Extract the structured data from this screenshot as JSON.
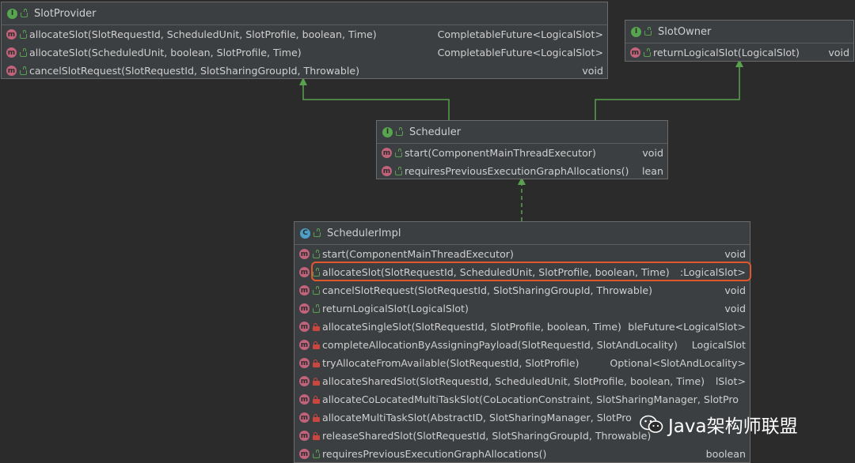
{
  "diagram": {
    "slot_provider": {
      "name": "SlotProvider",
      "kind_badge": "I",
      "methods": [
        {
          "badge": "m",
          "visibility": "public",
          "signature": "allocateSlot(SlotRequestId, ScheduledUnit, SlotProfile, boolean, Time)",
          "returns": "CompletableFuture<LogicalSlot>"
        },
        {
          "badge": "m",
          "visibility": "public",
          "signature": "allocateSlot(ScheduledUnit, boolean, SlotProfile, Time)",
          "returns": "CompletableFuture<LogicalSlot>"
        },
        {
          "badge": "m",
          "visibility": "public",
          "signature": "cancelSlotRequest(SlotRequestId, SlotSharingGroupId, Throwable)",
          "returns": "void"
        }
      ]
    },
    "slot_owner": {
      "name": "SlotOwner",
      "kind_badge": "I",
      "methods": [
        {
          "badge": "m",
          "visibility": "public",
          "signature": "returnLogicalSlot(LogicalSlot)",
          "returns": "void"
        }
      ]
    },
    "scheduler": {
      "name": "Scheduler",
      "kind_badge": "I",
      "methods": [
        {
          "badge": "m",
          "visibility": "public",
          "signature": "start(ComponentMainThreadExecutor)",
          "returns": "void"
        },
        {
          "badge": "m",
          "visibility": "public",
          "signature": "requiresPreviousExecutionGraphAllocations()",
          "returns": "lean"
        }
      ]
    },
    "scheduler_impl": {
      "name": "SchedulerImpl",
      "kind_badge": "C",
      "methods": [
        {
          "badge": "m",
          "visibility": "public",
          "signature": "start(ComponentMainThreadExecutor)",
          "returns": "void"
        },
        {
          "badge": "m",
          "visibility": "public",
          "signature": "allocateSlot(SlotRequestId, ScheduledUnit, SlotProfile, boolean, Time)",
          "returns": ":LogicalSlot>",
          "highlighted": true
        },
        {
          "badge": "m",
          "visibility": "public",
          "signature": "cancelSlotRequest(SlotRequestId, SlotSharingGroupId, Throwable)",
          "returns": "void"
        },
        {
          "badge": "m",
          "visibility": "public",
          "signature": "returnLogicalSlot(LogicalSlot)",
          "returns": "void"
        },
        {
          "badge": "m",
          "visibility": "private",
          "signature": "allocateSingleSlot(SlotRequestId, SlotProfile, boolean, Time)",
          "returns": "bleFuture<LogicalSlot>"
        },
        {
          "badge": "m",
          "visibility": "private",
          "signature": "completeAllocationByAssigningPayload(SlotRequestId, SlotAndLocality)",
          "returns": "LogicalSlot"
        },
        {
          "badge": "m",
          "visibility": "private",
          "signature": "tryAllocateFromAvailable(SlotRequestId, SlotProfile)",
          "returns": "Optional<SlotAndLocality>"
        },
        {
          "badge": "m",
          "visibility": "private",
          "signature": "allocateSharedSlot(SlotRequestId, ScheduledUnit, SlotProfile, boolean, Time)",
          "returns": "lSlot>"
        },
        {
          "badge": "m",
          "visibility": "private",
          "signature": "allocateCoLocatedMultiTaskSlot(CoLocationConstraint, SlotSharingManager, SlotPro",
          "returns": ""
        },
        {
          "badge": "m",
          "visibility": "private",
          "signature": "allocateMultiTaskSlot(AbstractID, SlotSharingManager, SlotPro",
          "returns": ""
        },
        {
          "badge": "m",
          "visibility": "private",
          "signature": "releaseSharedSlot(SlotRequestId, SlotSharingGroupId, Throwable)",
          "returns": ""
        },
        {
          "badge": "m",
          "visibility": "public",
          "signature": "requiresPreviousExecutionGraphAllocations()",
          "returns": "boolean"
        }
      ]
    }
  },
  "watermark": {
    "text": "Java架构师联盟",
    "icon": "wechat-icon"
  },
  "colors": {
    "background": "#2b2b2b",
    "box": "#3c3f41",
    "arrow": "#59a14f",
    "highlight": "#e0582b",
    "interface_badge": "#57a54f",
    "class_badge": "#4d9fc7",
    "method_badge": "#c0637b"
  }
}
